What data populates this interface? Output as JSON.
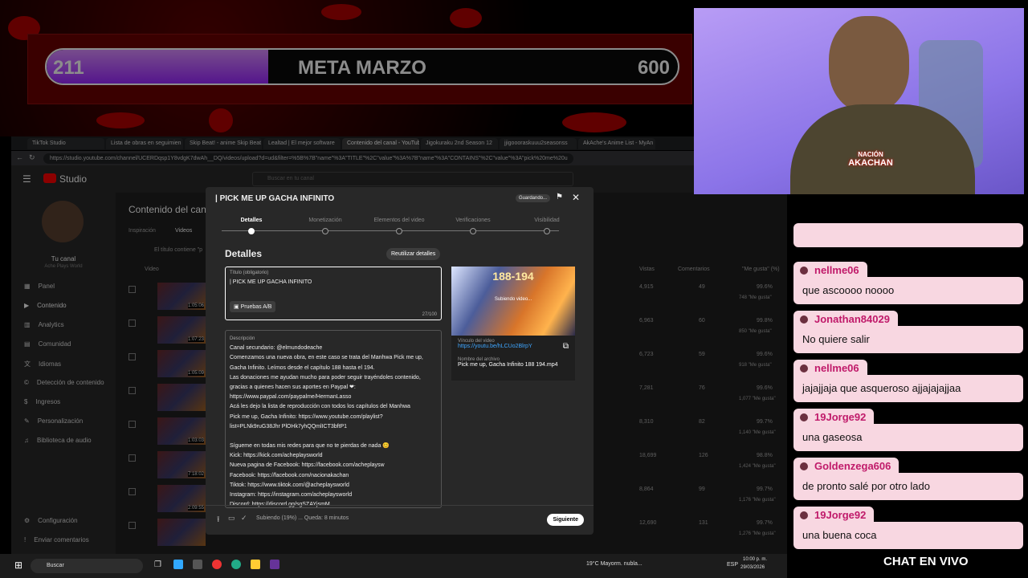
{
  "goal_bar": {
    "current": "211",
    "title": "META MARZO",
    "target": "600",
    "progress": 0.351
  },
  "browser": {
    "tabs": [
      "TikTok Studio",
      "Lista de obras en seguimien",
      "Skip Beat! - anime Skip Beat",
      "Lealtad | El mejor software",
      "Contenido del canal - YouTub",
      "Jigokuraku 2nd Season 12",
      "jjigoooraskuuu2seasonss",
      "AkAche's Anime List - MyAn"
    ],
    "active_tab": 4,
    "url": "https://studio.youtube.com/channel/UCERDqsp1Y8vdgK7dwAh__DQ/videos/upload?d=ud&filter=%5B%7B\"name\"%3A\"TITLE\"%2C\"value\"%3A%7B\"name\"%3A\"CONTAINS\"%2C\"value\"%3A\"pick%20me%20u"
  },
  "studio": {
    "logo": "Studio",
    "search_placeholder": "Buscar en tu canal",
    "channel_label": "Tu canal",
    "channel_name": "Ache Plays World",
    "nav": [
      "Panel",
      "Contenido",
      "Analytics",
      "Comunidad",
      "Idiomas",
      "Detección de contenido",
      "Ingresos",
      "Personalización",
      "Biblioteca de audio"
    ],
    "nav_bottom": [
      "Configuración",
      "Enviar comentarios"
    ],
    "page_title": "Contenido del canal",
    "content_tabs": [
      "Inspiración",
      "Videos"
    ],
    "filter_placeholder": "El título contiene \"p",
    "col_video": "Video",
    "columns": [
      "Vistas",
      "Comentarios",
      "\"Me gusta\" (%)"
    ],
    "rows": [
      {
        "views": "4,915",
        "comments": "49",
        "likes": "99.6%",
        "detail": "748 \"Me gusta\"",
        "duration": "1:05:06"
      },
      {
        "views": "6,963",
        "comments": "60",
        "likes": "99.8%",
        "detail": "850 \"Me gusta\"",
        "duration": "1:07:23"
      },
      {
        "views": "6,723",
        "comments": "59",
        "likes": "99.6%",
        "detail": "918 \"Me gusta\"",
        "duration": "1:05:09"
      },
      {
        "views": "7,281",
        "comments": "76",
        "likes": "99.6%",
        "detail": "1,077 \"Me gusta\"",
        "duration": ""
      },
      {
        "views": "8,310",
        "comments": "82",
        "likes": "99.7%",
        "detail": "1,140 \"Me gusta\"",
        "duration": "1:03:03"
      },
      {
        "views": "18,699",
        "comments": "126",
        "likes": "98.8%",
        "detail": "1,424 \"Me gusta\"",
        "duration": "7:18:02"
      },
      {
        "views": "8,864",
        "comments": "99",
        "likes": "99.7%",
        "detail": "1,176 \"Me gusta\"",
        "duration": "2:09:55"
      },
      {
        "views": "12,690",
        "comments": "131",
        "likes": "99.7%",
        "detail": "1,276 \"Me gusta\"",
        "duration": ""
      }
    ]
  },
  "modal": {
    "title": "| PICK ME UP GACHA INFINITO",
    "status": "Guardando...",
    "steps": [
      "Detalles",
      "Monetización",
      "Elementos del video",
      "Verificaciones",
      "Visibilidad"
    ],
    "section": "Detalles",
    "reuse_button": "Reutilizar detalles",
    "title_label": "Título (obligatorio)",
    "title_value": "| PICK ME UP GACHA INFINITO",
    "ab_button": "Pruebas A/B",
    "title_count": "27/100",
    "description_label": "Descripción",
    "description_lines": [
      "Canal secundario: @elmundodeache",
      "Comenzamos una nueva obra, en este caso se trata del Manhwa Pick me up,",
      "Gacha Infinito. Leímos desde el capítulo 188 hasta el 194.",
      "Las donaciones me ayudan mucho para poder seguir trayéndoles contenido,",
      "gracias a quienes hacen sus aportes en Paypal ❤:",
      "https://www.paypal.com/paypalme/HermanLasso",
      "Acá les dejo la lista de reproducción con todos los capítulos del Manhwa",
      "Pick me up, Gacha Infinito: https://www.youtube.com/playlist?",
      "list=PLNk9ruG38Jhr PlOHk7yhQQmlICT3bftP1",
      "",
      "Sígueme en todas mis redes para que no te pierdas de nada 😊",
      "Kick: https://kick.com/acheplaysworld",
      "Nueva pagina de Facebook: https://facebook.com/acheplaysw",
      "Facebook: https://facebook.com/nacionakachan",
      "Tiktok: https://www.tiktok.com/@acheplaysworld",
      "Instagram: https://instagram.com/acheplaysworld",
      "Discord: https://discord.gg/sgSZAYjsmM"
    ],
    "thumb_text": "188-194",
    "thumb_overlay": "Subiendo video...",
    "link_label": "Vínculo del video",
    "link": "https://youtu.be/hLCUo2BlrpY",
    "file_label": "Nombre del archivo",
    "file_name": "Pick me up, Gacha Infinito 188 194.mp4",
    "upload_status": "Subiendo (19%) ... Queda: 8 minutos",
    "next_button": "Siguiente"
  },
  "chat": {
    "label": "CHAT EN VIVO",
    "messages": [
      {
        "user": "nellme06",
        "text": "que ascoooo noooo"
      },
      {
        "user": "Jonathan84029",
        "text": "No quiere salir"
      },
      {
        "user": "nellme06",
        "text": "jajajjaja que asqueroso ajjajajajjaa"
      },
      {
        "user": "19Jorge92",
        "text": "una gaseosa"
      },
      {
        "user": "Goldenzega606",
        "text": "de pronto salé por otro lado"
      },
      {
        "user": "19Jorge92",
        "text": "una buena coca"
      }
    ]
  },
  "webcam": {
    "badge_line1": "NACIÓN",
    "badge_line2": "AKACHAN"
  },
  "taskbar": {
    "search": "Buscar",
    "weather": "19°C Mayorm. nubla...",
    "lang": "ESP",
    "time": "10:00 p. m.",
    "date": "29/03/2026"
  }
}
